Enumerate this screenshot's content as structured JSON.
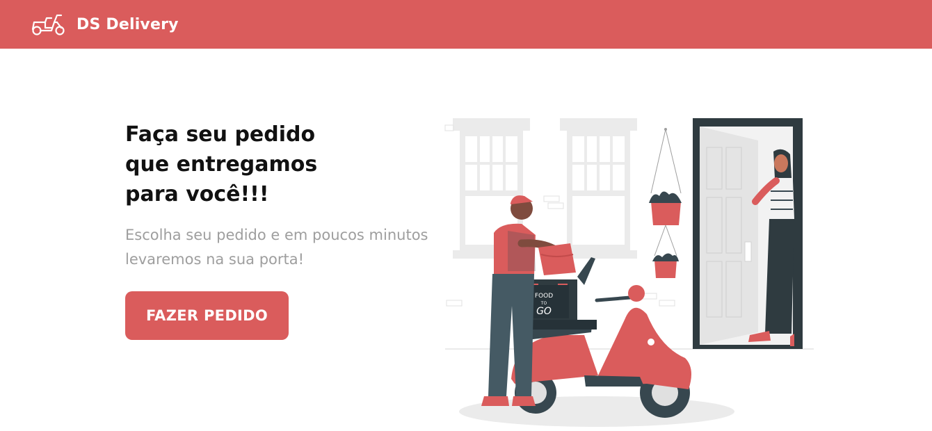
{
  "navbar": {
    "brand_name": "DS Delivery",
    "brand_icon": "scooter-icon",
    "background_color": "#DA5C5C"
  },
  "hero": {
    "title": "Faça seu pedido\nque entregamos\npara você!!!",
    "subtitle": "Escolha seu pedido e em poucos minutos\nlevaremos na sua porta!",
    "button_label": "FAZER PEDIDO",
    "illustration_box_text_top": "FOOD",
    "illustration_box_text_mid": "TO",
    "illustration_box_text_bottom": "GO"
  },
  "colors": {
    "accent": "#DA5C5C",
    "title": "#111111",
    "subtitle": "#9E9E9E"
  }
}
